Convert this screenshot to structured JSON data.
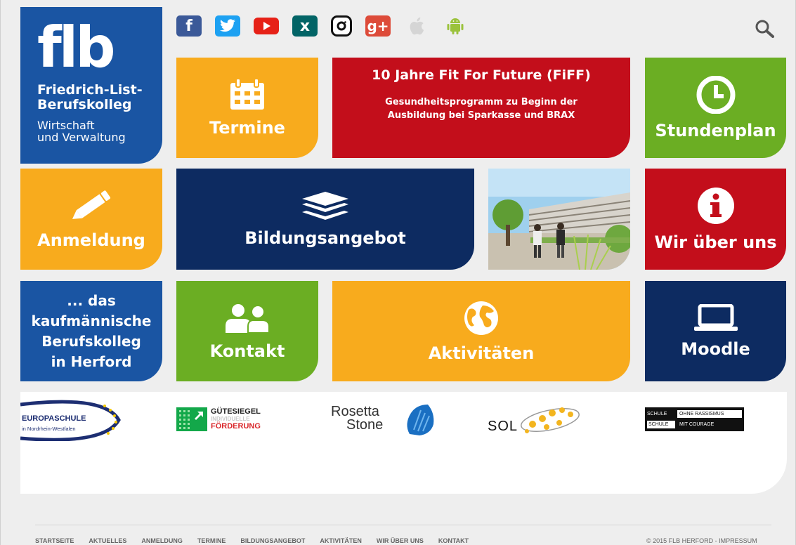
{
  "logo": {
    "mark": "flb",
    "name_line1": "Friedrich-List-",
    "name_line2": "Berufskolleg",
    "sub_line1": "Wirtschaft",
    "sub_line2": "und Verwaltung"
  },
  "social": {
    "facebook": "f",
    "xing": "x",
    "google_plus": "g+"
  },
  "tiles": {
    "termine": "Termine",
    "news_title": "10 Jahre Fit For Future (FiFF)",
    "news_subtitle": "Gesundheitsprogramm zu Beginn der Ausbildung bei Sparkasse und BRAX",
    "stundenplan": "Stundenplan",
    "anmeldung": "Anmeldung",
    "bildungsangebot": "Bildungsangebot",
    "wir_ueber_uns": "Wir über uns",
    "tagline": [
      "... das",
      "kaufmännische",
      "Berufskolleg",
      "in Herford"
    ],
    "kontakt": "Kontakt",
    "aktivitaeten": "Aktivitäten",
    "moodle": "Moodle"
  },
  "partners": {
    "europaschule_line1": "EUROPASCHULE",
    "europaschule_line2": "in Nordrhein-Westfalen",
    "guetesiegel_line1": "GÜTESIEGEL",
    "guetesiegel_line2": "INDIVIDUELLE",
    "guetesiegel_line3": "FÖRDERUNG",
    "rosetta_line1": "Rosetta",
    "rosetta_line2": "Stone",
    "sol": "SOL",
    "sor_row1_a": "SCHULE",
    "sor_row1_b": "OHNE RASSISMUS",
    "sor_row2_a": "SCHULE",
    "sor_row2_b": "MIT COURAGE"
  },
  "footer": {
    "nav": [
      "STARTSEITE",
      "AKTUELLES",
      "ANMELDUNG",
      "TERMINE",
      "BILDUNGSANGEBOT",
      "AKTIVITÄTEN",
      "WIR ÜBER UNS",
      "KONTAKT"
    ],
    "copyright": "© 2015 FLB HERFORD - IMPRESSUM"
  },
  "colors": {
    "orange": "#f8ab1d",
    "red": "#c30e1b",
    "green": "#6bae23",
    "navy": "#0d2b61",
    "blue": "#1a55a3"
  }
}
